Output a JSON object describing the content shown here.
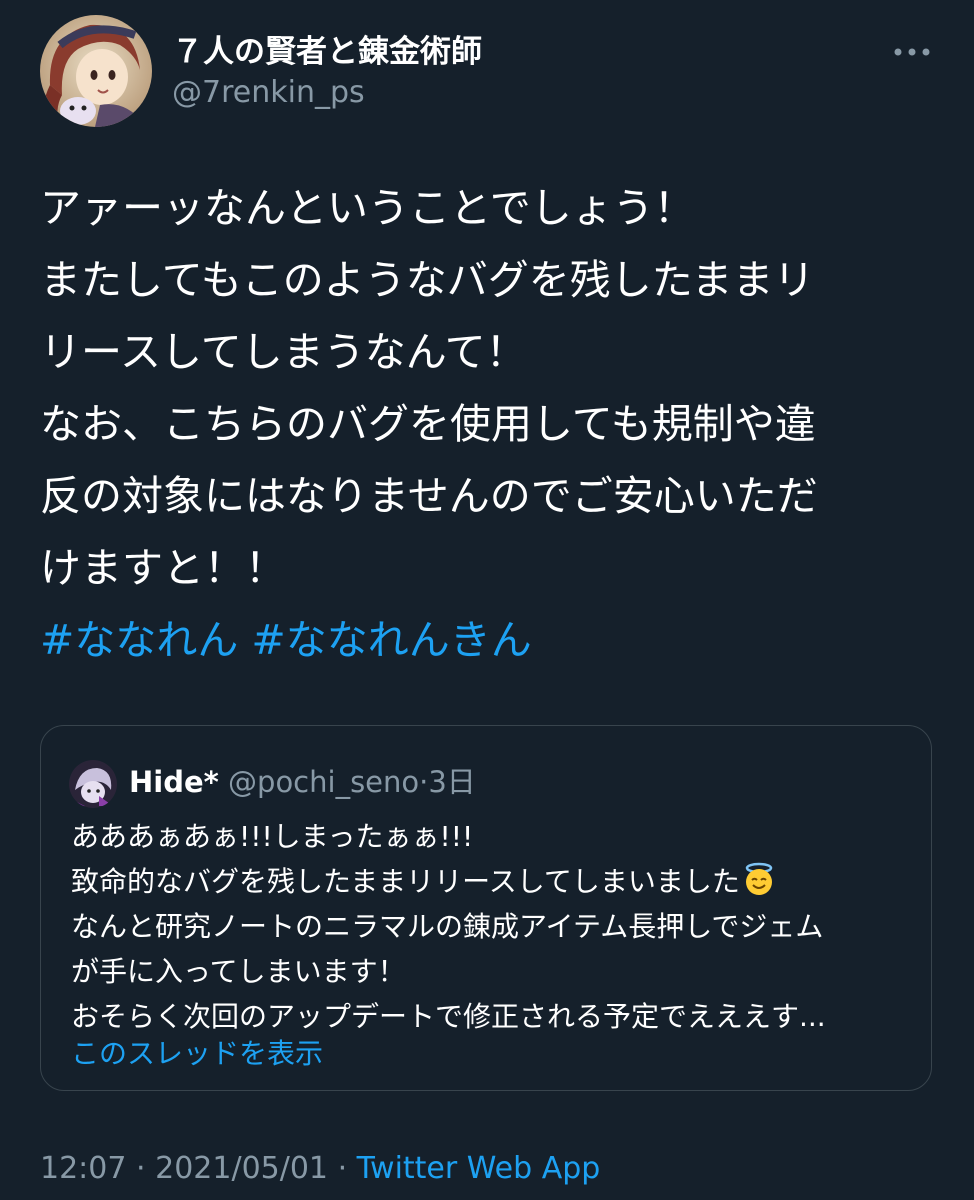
{
  "author": {
    "display_name": "７人の賢者と錬金術師",
    "handle": "@7renkin_ps"
  },
  "tweet": {
    "lines": [
      "アァーッなんということでしょう！",
      "またしてもこのようなバグを残したままリ",
      "リースしてしまうなんて！",
      "なお、こちらのバグを使用しても規制や違",
      "反の対象にはなりませんのでご安心いただ",
      "けますと！！"
    ],
    "hashtags": [
      "#ななれん",
      "#ななれんきん"
    ]
  },
  "quoted_tweet": {
    "display_name": "Hide*",
    "handle": "@pochi_seno",
    "separator": "·",
    "time": "3日",
    "lines": [
      "あああぁあぁ!!!しまったぁぁ!!!",
      "致命的なバグを残したままリリースしてしまいました",
      "なんと研究ノートのニラマルの錬成アイテム長押しでジェム",
      "が手に入ってしまいます！",
      "おそらく次回のアップデートで修正される予定でえええす..."
    ],
    "emoji_icon": "smiling-face-with-halo-icon",
    "thread_link": "このスレッドを表示"
  },
  "meta": {
    "time": "12:07",
    "separator": "·",
    "date": "2021/05/01",
    "source": "Twitter Web App"
  },
  "colors": {
    "background": "#15202b",
    "accent": "#1da1f2",
    "secondary_text": "#8899a6",
    "border": "#38444d"
  }
}
